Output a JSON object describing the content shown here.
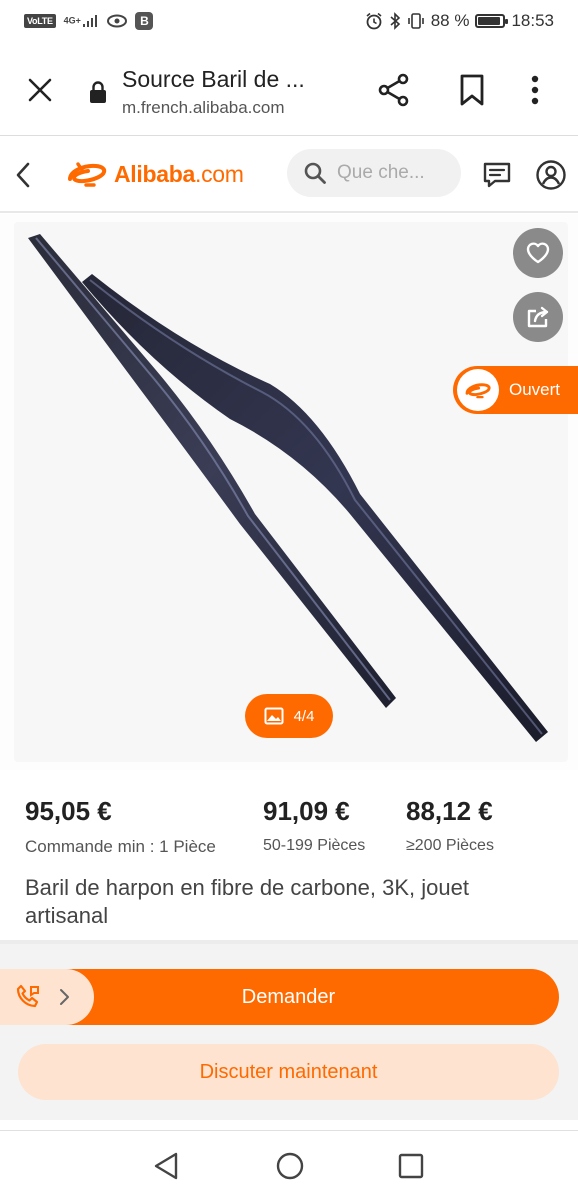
{
  "status_bar": {
    "volte": "VoLTE",
    "network": "4G+",
    "badge": "B",
    "battery_text": "88 %",
    "battery_level": 0.88,
    "time": "18:53"
  },
  "browser": {
    "page_title": "Source Baril de ...",
    "url": "m.french.alibaba.com"
  },
  "header": {
    "logo_brand": "Alibaba",
    "logo_tld": ".com",
    "search_placeholder": "Que che..."
  },
  "gallery": {
    "counter": "4/4",
    "supplier_status": "Ouvert"
  },
  "prices": [
    {
      "price": "95,05 €",
      "quantity": "Commande min : 1 Pièce"
    },
    {
      "price": "91,09 €",
      "quantity": "50-199 Pièces"
    },
    {
      "price": "88,12 €",
      "quantity": "≥200 Pièces"
    }
  ],
  "product": {
    "title": "Baril de harpon en fibre de carbone, 3K, jouet artisanal"
  },
  "actions": {
    "demander": "Demander",
    "chat": "Discuter maintenant"
  },
  "colors": {
    "accent": "#ff6a00",
    "accent_light": "#fde3d0",
    "fab_gray": "#8a8a8a"
  },
  "icons": {
    "close": "close-icon",
    "lock": "lock-icon",
    "share": "share-icon",
    "bookmark": "bookmark-icon",
    "menu": "more-vert-icon",
    "back": "chevron-left-icon",
    "search": "search-icon",
    "messages": "message-icon",
    "account": "user-icon",
    "favorite": "heart-icon",
    "share_product": "share-out-icon",
    "image": "image-icon",
    "phone": "phone-icon"
  }
}
